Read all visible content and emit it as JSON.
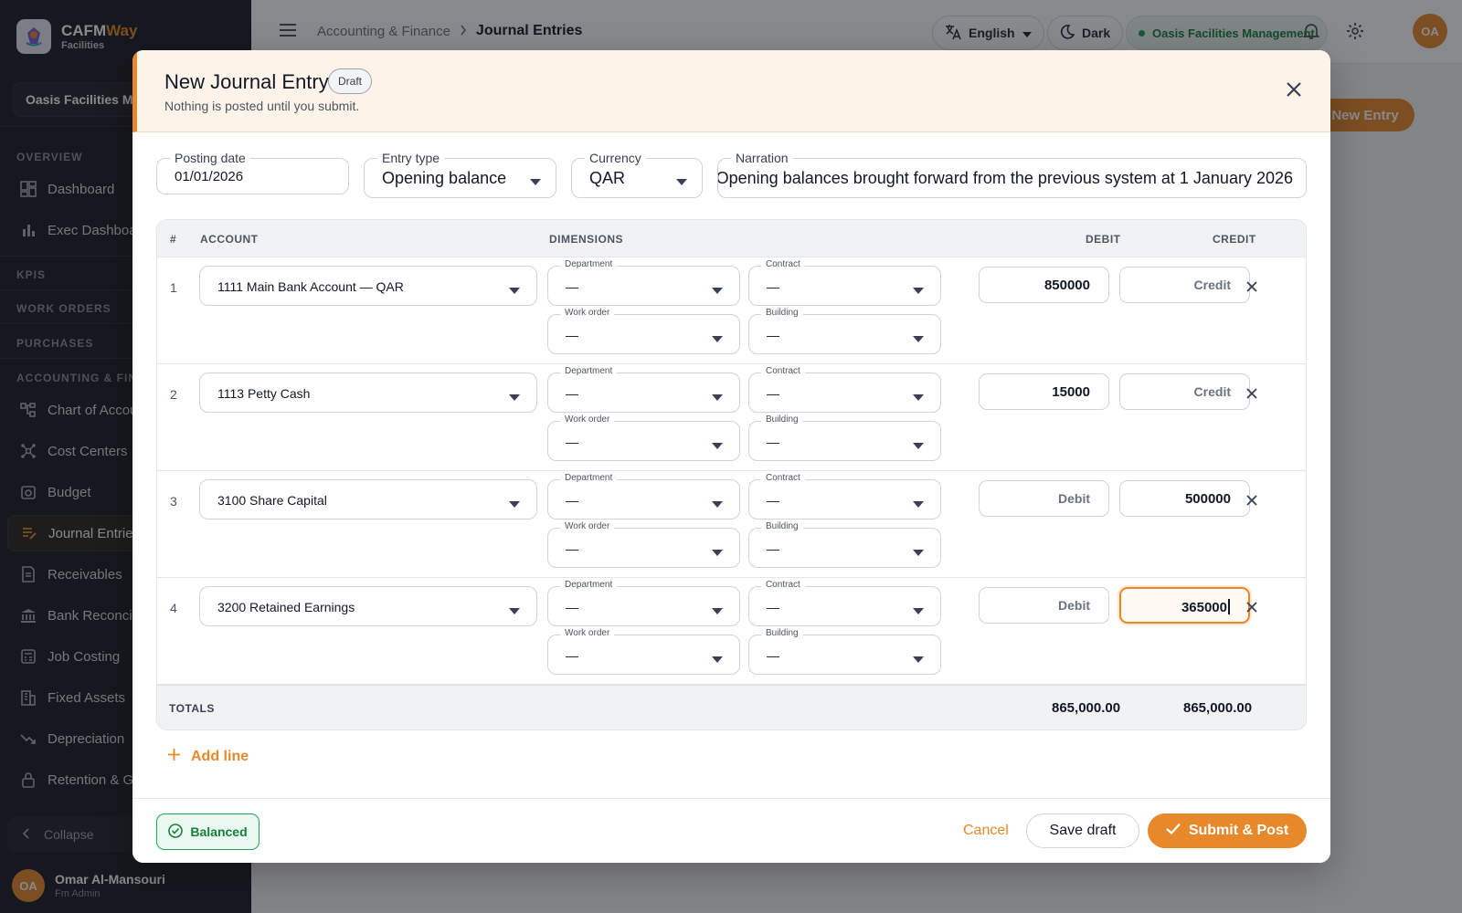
{
  "app": {
    "name_main": "CAFM",
    "name_accent": "Way",
    "name_sub": "Facilities",
    "org_selector": "Oasis Facilities Management"
  },
  "sidebar": {
    "sections": {
      "overview": "OVERVIEW",
      "kpis": "KPIS",
      "work_orders": "WORK ORDERS",
      "purchases": "PURCHASES",
      "accounting": "ACCOUNTING & FINANCE"
    },
    "items": [
      {
        "label": "Dashboard",
        "icon": "dashboard-icon"
      },
      {
        "label": "Exec Dashboard",
        "icon": "bar-chart-icon"
      },
      {
        "label": "Chart of Accounts",
        "icon": "tree-icon"
      },
      {
        "label": "Cost Centers",
        "icon": "hub-icon"
      },
      {
        "label": "Budget",
        "icon": "budget-icon"
      },
      {
        "label": "Journal Entries",
        "icon": "journal-icon",
        "active": true
      },
      {
        "label": "Receivables",
        "icon": "receipt-icon"
      },
      {
        "label": "Bank Reconciliation",
        "icon": "bank-icon"
      },
      {
        "label": "Job Costing",
        "icon": "calculator-icon"
      },
      {
        "label": "Fixed Assets",
        "icon": "building-icon"
      },
      {
        "label": "Depreciation",
        "icon": "trend-down-icon"
      },
      {
        "label": "Retention & Guarantees",
        "icon": "lock-icon"
      }
    ],
    "collapse_label": "Collapse",
    "user": {
      "initials": "OA",
      "name": "Omar Al-Mansouri",
      "role": "Fm Admin"
    }
  },
  "topbar": {
    "breadcrumb_parent": "Accounting & Finance",
    "breadcrumb_current": "Journal Entries",
    "language": "English",
    "theme": "Dark",
    "org": "Oasis Facilities Management",
    "avatar_initials": "OA",
    "new_entry_label": "New Entry"
  },
  "modal": {
    "title": "New Journal Entry",
    "status_badge": "Draft",
    "subtitle": "Nothing is posted until you submit.",
    "fields": {
      "posting_date": {
        "label": "Posting date",
        "value": "01/01/2026"
      },
      "entry_type": {
        "label": "Entry type",
        "value": "Opening balance"
      },
      "currency": {
        "label": "Currency",
        "value": "QAR"
      },
      "narration": {
        "label": "Narration",
        "value": "Opening balances brought forward from the previous system at 1 January 2026"
      }
    },
    "table": {
      "headers": {
        "num": "#",
        "account": "ACCOUNT",
        "dimensions": "DIMENSIONS",
        "debit": "DEBIT",
        "credit": "CREDIT"
      },
      "dimension_labels": {
        "department": "Department",
        "contract": "Contract",
        "work_order": "Work order",
        "building": "Building"
      },
      "empty_value": "—",
      "debit_placeholder": "Debit",
      "credit_placeholder": "Credit",
      "lines": [
        {
          "num": "1",
          "account": "1111  Main Bank Account — QAR",
          "department": "—",
          "contract": "—",
          "work_order": "—",
          "building": "—",
          "debit": "850000",
          "credit": ""
        },
        {
          "num": "2",
          "account": "1113  Petty Cash",
          "department": "—",
          "contract": "—",
          "work_order": "—",
          "building": "—",
          "debit": "15000",
          "credit": ""
        },
        {
          "num": "3",
          "account": "3100  Share Capital",
          "department": "—",
          "contract": "—",
          "work_order": "—",
          "building": "—",
          "debit": "",
          "credit": "500000"
        },
        {
          "num": "4",
          "account": "3200  Retained Earnings",
          "department": "—",
          "contract": "—",
          "work_order": "—",
          "building": "—",
          "debit": "",
          "credit": "365000"
        }
      ],
      "totals_label": "TOTALS",
      "total_debit": "865,000.00",
      "total_credit": "865,000.00"
    },
    "add_line_label": "Add line",
    "footer": {
      "balance_status": "Balanced",
      "cancel_label": "Cancel",
      "save_draft_label": "Save draft",
      "submit_label": "Submit & Post"
    }
  },
  "colors": {
    "accent": "#e7892a",
    "sidebar_bg": "#1b1d24",
    "success": "#15803d",
    "overlay": "rgba(17,19,26,0.5)"
  }
}
